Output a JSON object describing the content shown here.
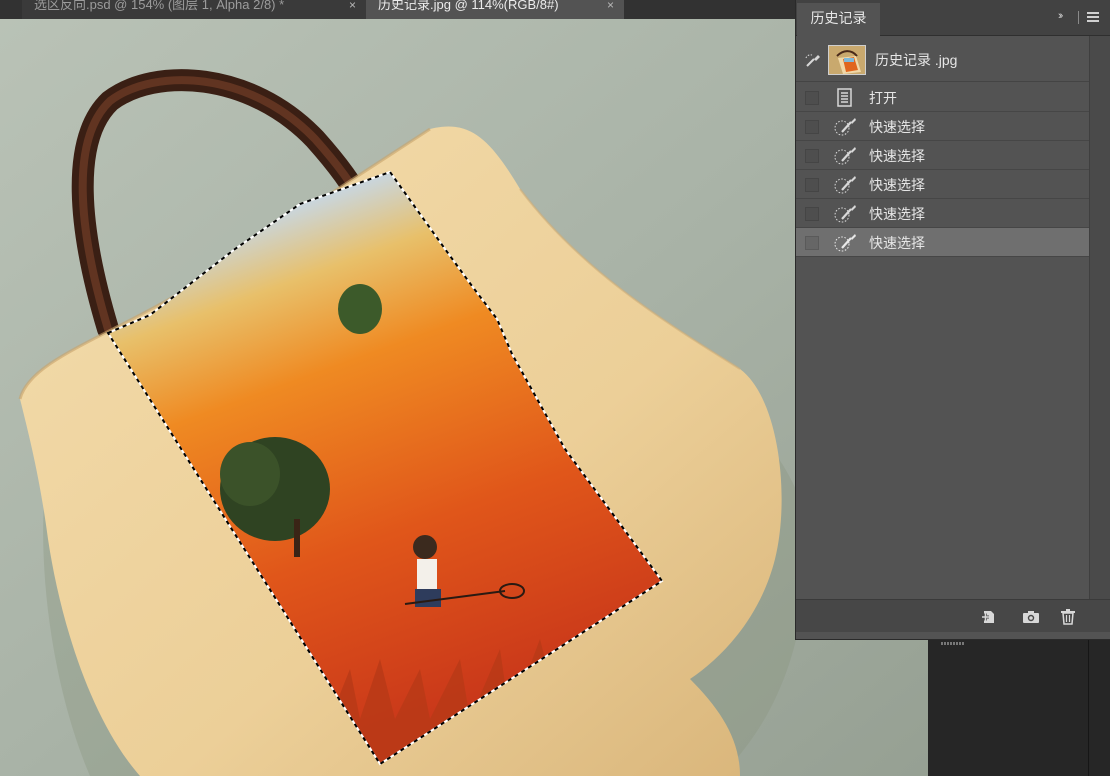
{
  "document_tabs": [
    {
      "label": "选区反向.psd @ 154% (图层 1, Alpha 2/8) *",
      "active": false,
      "close": "×"
    },
    {
      "label": "历史记录.jpg @ 114%(RGB/8#)",
      "active": true,
      "close": "×"
    }
  ],
  "history_panel": {
    "title": "历史记录",
    "collapse_glyph": "››",
    "snapshot": {
      "name": "历史记录 .jpg",
      "icon": "history-brush-icon"
    },
    "states": [
      {
        "label": "打开",
        "icon": "document-icon",
        "selected": false
      },
      {
        "label": "快速选择",
        "icon": "quick-selection-icon",
        "selected": false
      },
      {
        "label": "快速选择",
        "icon": "quick-selection-icon",
        "selected": false
      },
      {
        "label": "快速选择",
        "icon": "quick-selection-icon",
        "selected": false
      },
      {
        "label": "快速选择",
        "icon": "quick-selection-icon",
        "selected": false
      },
      {
        "label": "快速选择",
        "icon": "quick-selection-icon",
        "selected": true
      }
    ],
    "footer_buttons": [
      {
        "name": "new-document-from-state-icon"
      },
      {
        "name": "camera-icon"
      },
      {
        "name": "trash-icon"
      }
    ]
  },
  "colors": {
    "panel_bg": "#535353",
    "selected_row": "#6f6f6f",
    "canvas_backdrop": "#a8b2a6",
    "bag_canvas": "#eccf98",
    "painting_orange": "#e2661c",
    "painting_sky": "#7fb8d8"
  }
}
